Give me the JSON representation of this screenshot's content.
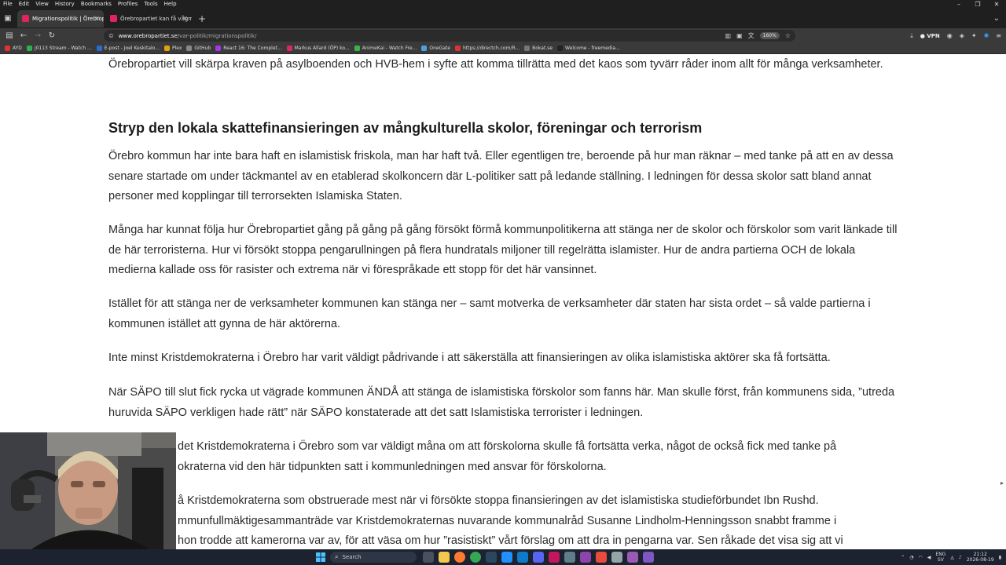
{
  "menubar": {
    "items": [
      "File",
      "Edit",
      "View",
      "History",
      "Bookmarks",
      "Profiles",
      "Tools",
      "Help"
    ]
  },
  "tabs": [
    {
      "title": "Migrationspolitik | Örebroparti",
      "active": true,
      "icon_color": "#e0245e"
    },
    {
      "title": "Örebropartiet kan få vågmästa",
      "active": false,
      "icon_color": "#e0245e"
    }
  ],
  "address": {
    "host": "www.orebropartiet.se",
    "path": "/var-politik/migrationspolitik/",
    "zoom": "160%",
    "vpn_label": "VPN"
  },
  "bookmarks": [
    {
      "label": "AYD",
      "color": "#d33"
    },
    {
      "label": "j0113 Stream - Watch ...",
      "color": "#2bb24c"
    },
    {
      "label": "E-post - Joel Keskitalo...",
      "color": "#2b6cd4"
    },
    {
      "label": "Plex",
      "color": "#e5a00d"
    },
    {
      "label": "GitHub",
      "color": "#888"
    },
    {
      "label": "React 16: The Complet...",
      "color": "#a435f0"
    },
    {
      "label": "Markus Allard (ÖP) ko...",
      "color": "#e0245e"
    },
    {
      "label": "AnimeKai - Watch Fre...",
      "color": "#3bb34a"
    },
    {
      "label": "OneGate",
      "color": "#4aa3df"
    },
    {
      "label": "https://directch.com/R...",
      "color": "#d33"
    },
    {
      "label": "Bokat.se",
      "color": "#777"
    },
    {
      "label": "Welcome - freemedia...",
      "color": "#222"
    }
  ],
  "article": {
    "p_intro": "Örebropartiet vill skärpa kraven på asylboenden och HVB-hem i syfte att komma tillrätta med det kaos som tyvärr råder inom allt för många verksamheter.",
    "heading": "Stryp den lokala skattefinansieringen av mångkulturella skolor, föreningar och terrorism",
    "p1": "Örebro kommun har inte bara haft en islamistisk friskola, man har haft två. Eller egentligen tre, beroende på hur man räknar – med tanke på att en av dessa senare startade om under täckmantel av en etablerad skolkoncern där L-politiker satt på ledande ställning. I ledningen för dessa skolor satt bland annat personer med kopplingar till terrorsekten Islamiska Staten.",
    "p2": "Många har kunnat följa hur Örebropartiet gång på gång på gång försökt förmå kommunpolitikerna att stänga ner de skolor och förskolor som varit länkade till de här terroristerna. Hur vi försökt stoppa pengarullningen på flera hundratals miljoner till regelrätta islamister. Hur de andra partierna OCH de lokala medierna kallade oss för rasister och extrema när vi förespråkade ett stopp för det här vansinnet.",
    "p3": "Istället för att stänga ner de verksamheter kommunen kan stänga ner – samt motverka de verksamheter där staten har sista ordet – så valde partierna i kommunen istället att gynna de här aktörerna.",
    "p4": "Inte minst Kristdemokraterna i Örebro har varit väldigt pådrivande i att säkerställa att finansieringen av olika islamistiska aktörer ska få fortsätta.",
    "p5": "När SÄPO till slut fick rycka ut vägrade kommunen ÄNDÅ att stänga de islamistiska förskolor som fanns här. Man skulle först, från kommunens sida, ”utreda huruvida SÄPO verkligen hade rätt” när SÄPO konstaterade att det satt Islamistiska terrorister i ledningen.",
    "p6_line1": "det Kristdemokraterna i Örebro som var väldigt måna om att förskolorna skulle få fortsätta verka, något de också fick med tanke på",
    "p6_line2": "okraterna vid den här tidpunkten satt i kommunledningen med ansvar för förskolorna.",
    "p7_line1": "å Kristdemokraterna som obstruerade mest när vi försökte stoppa finansieringen av det islamistiska studieförbundet Ibn Rushd.",
    "p7_line2": "mmunfullmäktigesammanträde var Kristdemokraternas nuvarande kommunalråd Susanne Lindholm-Henningsson snabbt framme i",
    "p7_line3": "hon trodde att kamerorna var av, för att väsa om hur ”rasistiskt” vårt förslag om att dra in pengarna var. Sen råkade det visa sig att vi"
  },
  "taskbar": {
    "search_placeholder": "Search",
    "lang_top": "ENG",
    "lang_bottom": "SV",
    "time": "21:12",
    "date": "2026-08-19"
  }
}
